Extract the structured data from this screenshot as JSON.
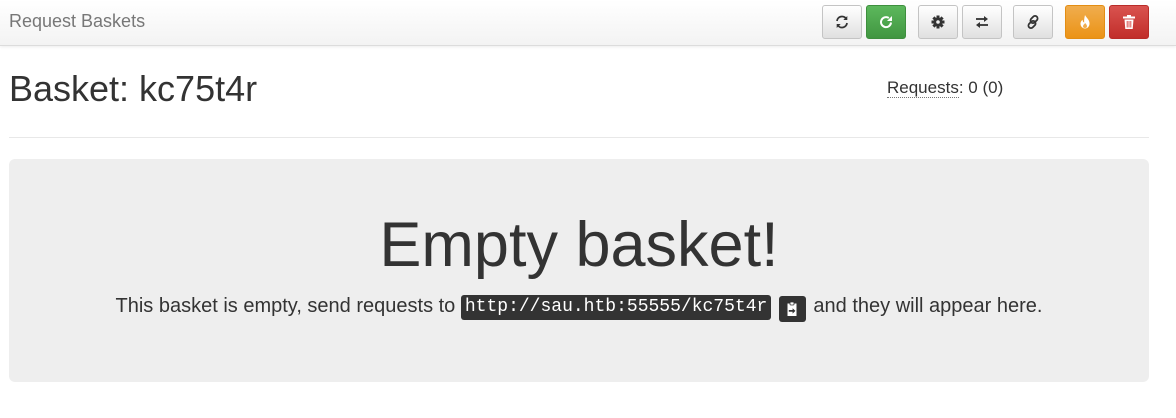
{
  "navbar": {
    "brand": "Request Baskets",
    "buttons": [
      {
        "name": "refresh-button",
        "icon": "refresh-icon",
        "style": "default"
      },
      {
        "name": "auto-refresh-button",
        "icon": "auto-refresh-icon",
        "style": "success"
      },
      {
        "name": "settings-button",
        "icon": "gear-icon",
        "style": "default"
      },
      {
        "name": "responses-button",
        "icon": "transfer-icon",
        "style": "default"
      },
      {
        "name": "share-link-button",
        "icon": "link-icon",
        "style": "default"
      },
      {
        "name": "clear-basket-button",
        "icon": "fire-icon",
        "style": "warning"
      },
      {
        "name": "delete-basket-button",
        "icon": "trash-icon",
        "style": "danger"
      }
    ]
  },
  "basket": {
    "title": "Basket: kc75t4r",
    "requests_label": "Requests",
    "requests_value": ": 0 (0)"
  },
  "empty": {
    "heading": "Empty basket!",
    "text_before": "This basket is empty, send requests to ",
    "url": "http://sau.htb:55555/kc75t4r",
    "text_after": " and they will appear here.",
    "copy_icon": "clipboard-icon"
  },
  "colors": {
    "success": "#5cb85c",
    "warning": "#f0ad4e",
    "danger": "#d9534f",
    "jumbotron_bg": "#eeeeee",
    "code_bg": "#333333"
  }
}
